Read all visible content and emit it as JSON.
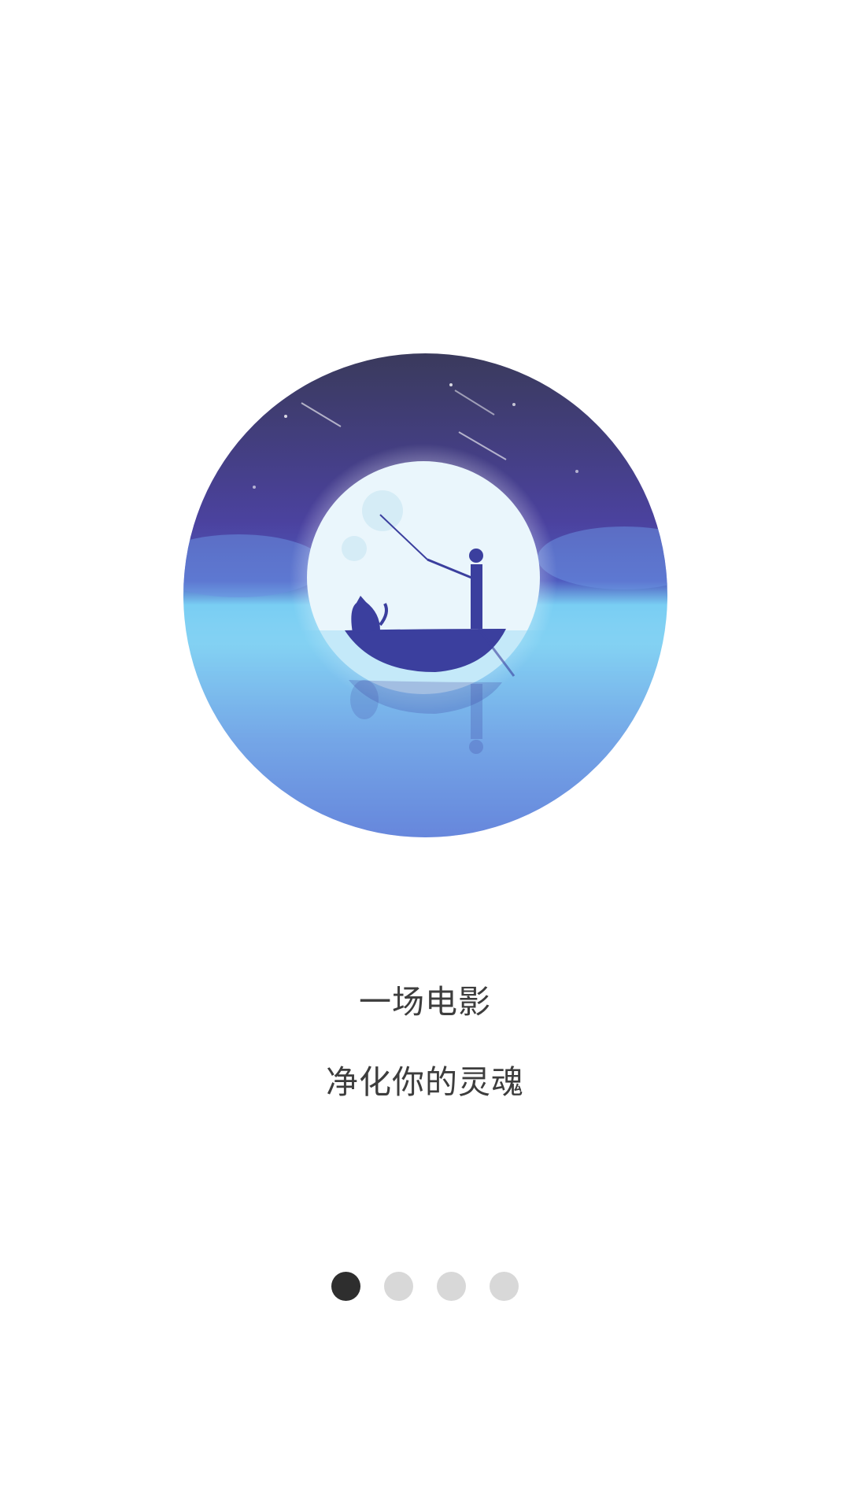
{
  "onboarding": {
    "line1": "一场电影",
    "line2": "净化你的灵魂",
    "page_count": 4,
    "current_page": 1
  },
  "colors": {
    "sky_top": "#3a3a5c",
    "sky_mid": "#4e46a8",
    "horizon": "#74c8f0",
    "water_bottom": "#5a5fd0",
    "moon": "#eaf6fc",
    "silhouette": "#3b3f9e",
    "dot_active": "#2e2e2e",
    "dot_inactive": "#d8d8d8",
    "text": "#3d3d3d"
  },
  "icons": {
    "hero": "moon-boat-illustration"
  }
}
